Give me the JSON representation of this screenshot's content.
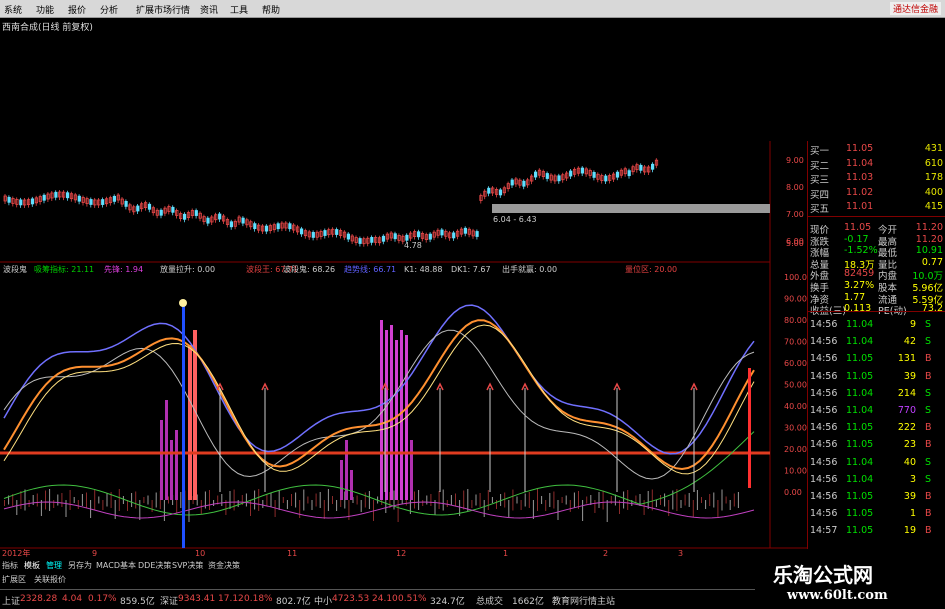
{
  "menubar": {
    "items": [
      "系统",
      "功能",
      "报价",
      "分析",
      "扩展市场行情",
      "资讯",
      "工具",
      "帮助"
    ],
    "brand": "通达信金融"
  },
  "stock_title": "西南合成(日线 前复权)",
  "main_chart": {
    "price_ticks": [
      "9.00",
      "8.00",
      "7.00",
      "6.00",
      "5.00"
    ],
    "low_label": "4.78",
    "range_label": "6.04 - 6.43"
  },
  "indicator_header": {
    "items": [
      {
        "text": "波段鬼",
        "color": "#cccccc"
      },
      {
        "text": "吸筹指标: 21.11",
        "color": "#00d000"
      },
      {
        "text": "先锋: 1.94",
        "color": "#e040e0"
      },
      {
        "text": "放量拉升: 0.00",
        "color": "#cccccc"
      },
      {
        "text": "波段王: 67.71",
        "color": "#e04040"
      },
      {
        "text": "波段鬼: 68.26",
        "color": "#cccccc"
      },
      {
        "text": "趋势线: 66.71",
        "color": "#6060ff"
      },
      {
        "text": "K1: 48.88",
        "color": "#cccccc"
      },
      {
        "text": "DK1: 7.67",
        "color": "#cccccc"
      },
      {
        "text": "出手就赢: 0.00",
        "color": "#cccccc"
      },
      {
        "text": "量位区: 20.00",
        "color": "#e04040"
      }
    ]
  },
  "osc_ticks": [
    "100.0",
    "90.00",
    "80.00",
    "70.00",
    "60.00",
    "50.00",
    "40.00",
    "30.00",
    "20.00",
    "10.00",
    "0.00"
  ],
  "date_axis": [
    "2012年",
    "9",
    "10",
    "11",
    "12",
    "1",
    "2",
    "3"
  ],
  "quote": {
    "bids": [
      {
        "label": "买一",
        "price": "11.05",
        "vol": "431"
      },
      {
        "label": "买二",
        "price": "11.04",
        "vol": "610"
      },
      {
        "label": "买三",
        "price": "11.03",
        "vol": "178"
      },
      {
        "label": "买四",
        "price": "11.02",
        "vol": "400"
      },
      {
        "label": "买五",
        "price": "11.01",
        "vol": "415"
      }
    ]
  },
  "info": {
    "rows": [
      {
        "l1": "现价",
        "v1": "11.05",
        "l2": "今开",
        "v2": "11.20"
      },
      {
        "l1": "涨跌",
        "v1": "-0.17",
        "l2": "最高",
        "v2": "11.20"
      },
      {
        "l1": "涨幅",
        "v1": "-1.52%",
        "l2": "最低",
        "v2": "10.91"
      },
      {
        "l1": "总量",
        "v1": "18.3万",
        "l2": "量比",
        "v2": "0.77"
      },
      {
        "l1": "外盘",
        "v1": "82459",
        "l2": "内盘",
        "v2": "10.0万"
      },
      {
        "l1": "换手",
        "v1": "3.27%",
        "l2": "股本",
        "v2": "5.96亿"
      },
      {
        "l1": "净资",
        "v1": "1.77",
        "l2": "流通",
        "v2": "5.59亿"
      },
      {
        "l1": "收益(三)",
        "v1": "0.113",
        "l2": "PE(动)",
        "v2": "73.2"
      }
    ]
  },
  "ticks": {
    "rows": [
      {
        "time": "14:56",
        "price": "11.04",
        "vol": "9",
        "side": "S"
      },
      {
        "time": "14:56",
        "price": "11.04",
        "vol": "42",
        "side": "S"
      },
      {
        "time": "14:56",
        "price": "11.05",
        "vol": "131",
        "side": "B"
      },
      {
        "time": "14:56",
        "price": "11.05",
        "vol": "39",
        "side": "B"
      },
      {
        "time": "14:56",
        "price": "11.04",
        "vol": "214",
        "side": "S"
      },
      {
        "time": "14:56",
        "price": "11.04",
        "vol": "770",
        "side": "S"
      },
      {
        "time": "14:56",
        "price": "11.05",
        "vol": "222",
        "side": "B"
      },
      {
        "time": "14:56",
        "price": "11.05",
        "vol": "23",
        "side": "B"
      },
      {
        "time": "14:56",
        "price": "11.04",
        "vol": "40",
        "side": "S"
      },
      {
        "time": "14:56",
        "price": "11.04",
        "vol": "3",
        "side": "S"
      },
      {
        "time": "14:56",
        "price": "11.05",
        "vol": "39",
        "side": "B"
      },
      {
        "time": "14:56",
        "price": "11.05",
        "vol": "1",
        "side": "B"
      },
      {
        "time": "14:57",
        "price": "11.05",
        "vol": "19",
        "side": "B"
      }
    ]
  },
  "tabs": [
    "指标",
    "模板",
    "管理",
    "另存为",
    "MACD基本",
    "DDE决策",
    "SVP决策",
    "资金决策"
  ],
  "subtabs": [
    "扩展区",
    "关联报价"
  ],
  "status": {
    "sh_label": "上证",
    "sh_value": "2328.28",
    "sh_change": "4.04",
    "sh_pct": "0.17%",
    "sh_amount": "859.5亿",
    "sz_label": "深证",
    "sz_value": "9343.41",
    "sz_change": "17.12",
    "sz_pct": "0.18%",
    "sz_amount": "802.7亿",
    "zx_label": "中小",
    "zx_value": "4723.53",
    "zx_change": "24.10",
    "zx_pct": "0.51%",
    "zx_amount": "324.7亿",
    "total_label": "总成交",
    "total_value": "1662亿",
    "site_label": "教育网行情主站"
  },
  "watermark": {
    "line1": "乐淘公式网",
    "line2": "www.60lt.com"
  },
  "colors": {
    "up": "#e84848",
    "down": "#00e0e0",
    "bg": "#000000",
    "grid": "#800000"
  }
}
